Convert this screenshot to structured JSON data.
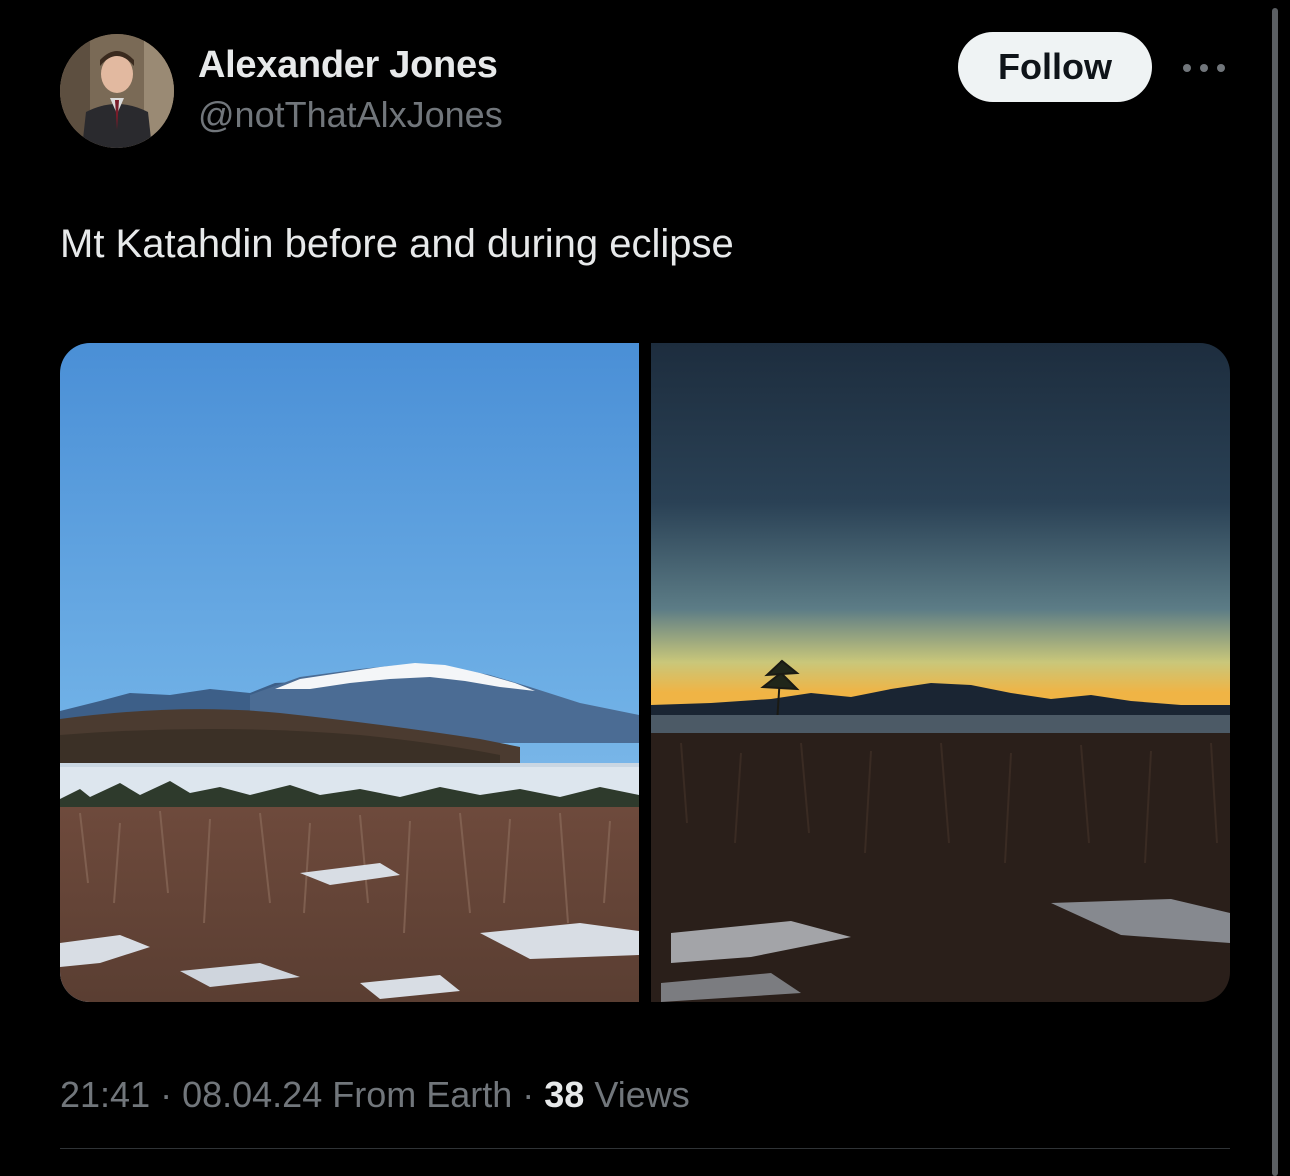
{
  "author": {
    "display_name": "Alexander Jones",
    "handle": "@notThatAlxJones",
    "avatar_icon": "profile-photo"
  },
  "actions": {
    "follow_label": "Follow",
    "more_icon": "more-horizontal-icon"
  },
  "tweet": {
    "text": "Mt Katahdin before and during eclipse"
  },
  "media": [
    {
      "kind": "photo",
      "subject": "mountain-daylight"
    },
    {
      "kind": "photo",
      "subject": "mountain-eclipse"
    }
  ],
  "meta": {
    "time": "21:41",
    "sep1": " · ",
    "date": "08.04.24",
    "source": " From Earth",
    "sep2": " · ",
    "views_count": "38",
    "views_label": " Views"
  },
  "colors": {
    "background": "#000000",
    "primary_text": "#e7e9ea",
    "secondary_text": "#71767b",
    "follow_button_bg": "#eff3f4",
    "divider": "#2f3336"
  }
}
